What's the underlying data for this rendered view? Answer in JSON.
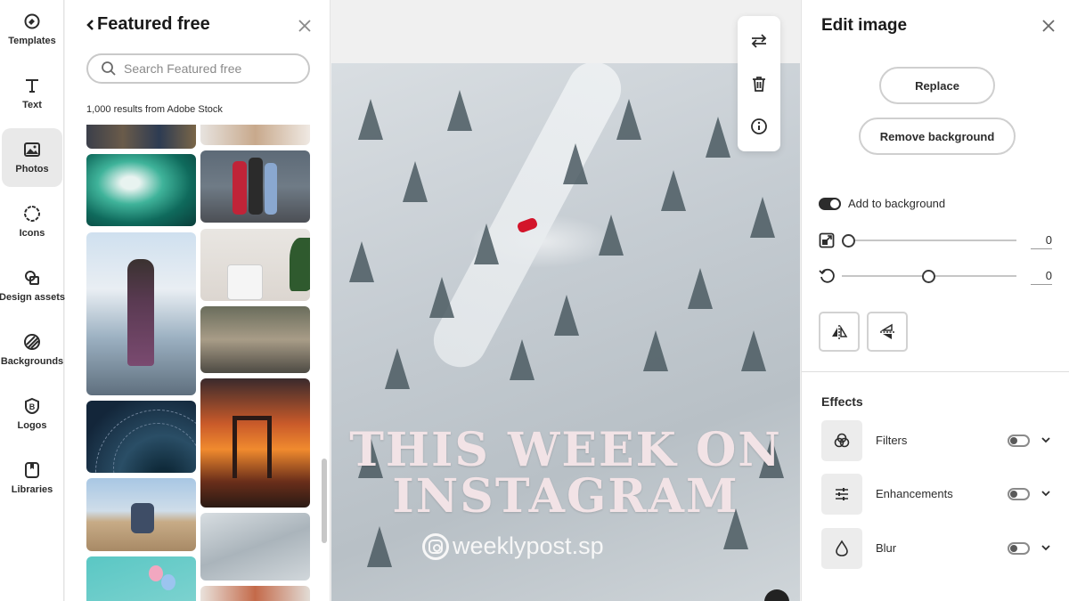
{
  "rail": {
    "items": [
      {
        "label": "Templates",
        "icon": "templates-icon"
      },
      {
        "label": "Text",
        "icon": "text-icon"
      },
      {
        "label": "Photos",
        "icon": "photos-icon",
        "active": true
      },
      {
        "label": "Icons",
        "icon": "icons-icon"
      },
      {
        "label": "Design assets",
        "icon": "design-assets-icon"
      },
      {
        "label": "Backgrounds",
        "icon": "backgrounds-icon"
      },
      {
        "label": "Logos",
        "icon": "logos-icon"
      },
      {
        "label": "Libraries",
        "icon": "libraries-icon"
      }
    ]
  },
  "panel": {
    "title": "Featured free",
    "search_placeholder": "Search Featured free",
    "results_text": "1,000 results from Adobe Stock"
  },
  "canvas": {
    "headline_line1": "THIS WEEK ON",
    "headline_line2": "INSTAGRAM",
    "handle": "weeklypost.sp"
  },
  "float_toolbar": {
    "buttons": [
      "replace-swap-icon",
      "trash-icon",
      "info-icon"
    ]
  },
  "edit": {
    "title": "Edit image",
    "replace_label": "Replace",
    "remove_bg_label": "Remove background",
    "add_to_bg_label": "Add to background",
    "add_to_bg_on": true,
    "scale_value": "0",
    "rotate_value": "0",
    "scale_level": 0.0,
    "rotate_level": 0.5,
    "effects_title": "Effects",
    "effects": [
      {
        "label": "Filters",
        "icon": "filters-icon",
        "on": false
      },
      {
        "label": "Enhancements",
        "icon": "sliders-icon",
        "on": false
      },
      {
        "label": "Blur",
        "icon": "droplet-icon",
        "on": false
      }
    ]
  },
  "colors": {
    "accent_dark": "#2c2c2c",
    "headline_pink": "#f2e3e6",
    "car_red": "#d3142a"
  }
}
